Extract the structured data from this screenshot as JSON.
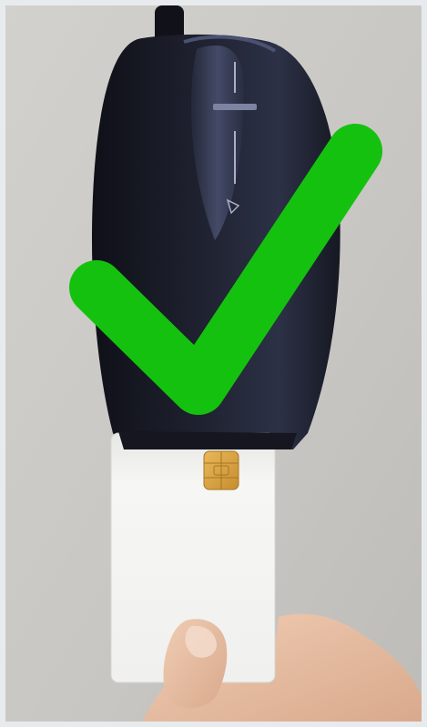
{
  "scene": {
    "subject": "smart-card-reader",
    "overlay": "check-mark-icon",
    "colors": {
      "wall": "#c9c7c3",
      "reader": "#1d1f2b",
      "reader_highlight": "#3a3f58",
      "card": "#f4f4f2",
      "chip": "#d9a441",
      "check": "#15c10f",
      "skin": "#e9c3a8"
    }
  }
}
